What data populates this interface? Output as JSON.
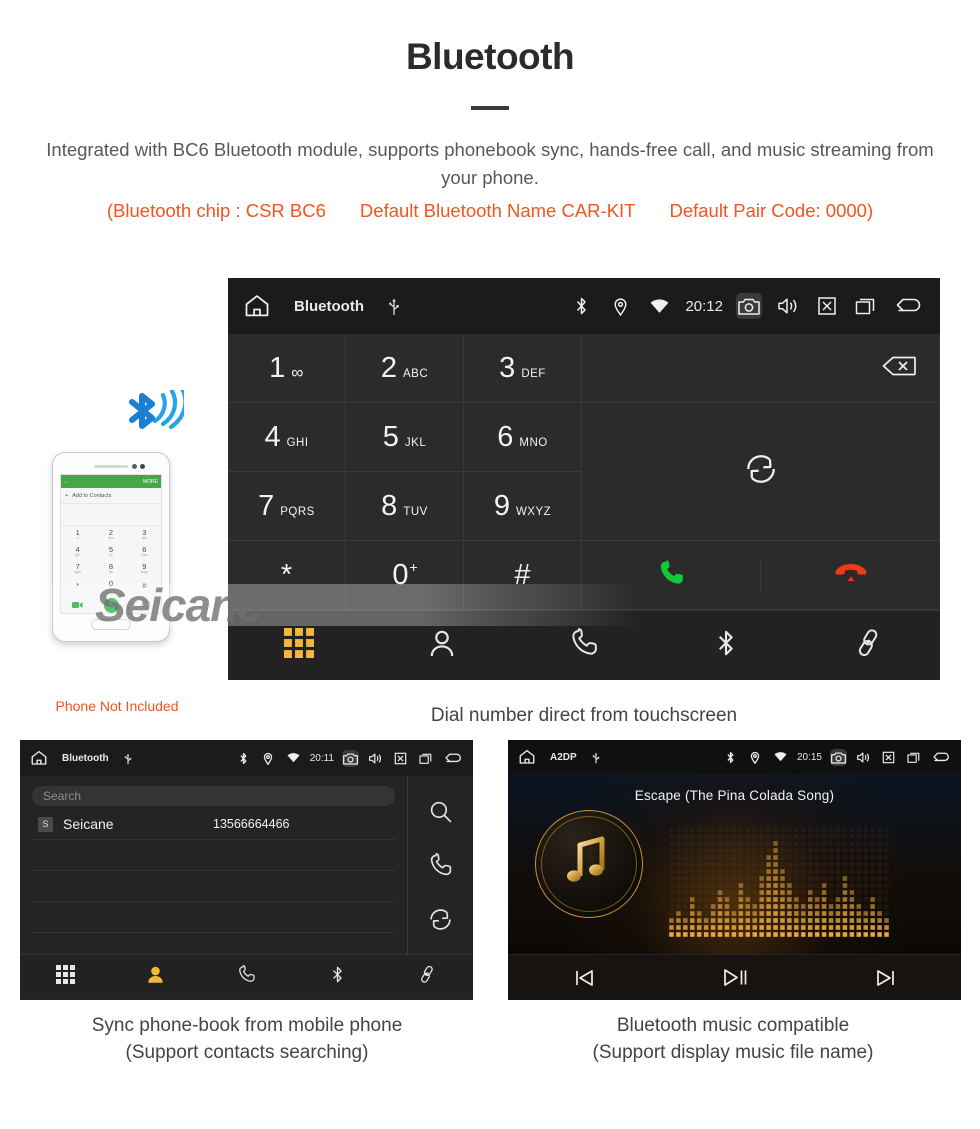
{
  "header": {
    "title": "Bluetooth",
    "description": "Integrated with BC6 Bluetooth module, supports phonebook sync, hands-free call, and music streaming from your phone.",
    "notes": [
      "(Bluetooth chip : CSR BC6",
      "Default Bluetooth Name CAR-KIT",
      "Default Pair Code: 0000)"
    ],
    "accent_color": "#f4541f",
    "text_color": "#585858"
  },
  "watermark": "Seicane",
  "phone_mock": {
    "caption": "Phone Not Included",
    "appbar_more": "MORE",
    "add_to_contacts": "Add to Contacts",
    "back_arrow": "←",
    "plus": "+",
    "keys": [
      {
        "digit": "1",
        "sub": "∞"
      },
      {
        "digit": "2",
        "sub": "abc"
      },
      {
        "digit": "3",
        "sub": "def"
      },
      {
        "digit": "4",
        "sub": "ghi"
      },
      {
        "digit": "5",
        "sub": "jkl"
      },
      {
        "digit": "6",
        "sub": "mno"
      },
      {
        "digit": "7",
        "sub": "pqrs"
      },
      {
        "digit": "8",
        "sub": "tuv"
      },
      {
        "digit": "9",
        "sub": "wxyz"
      },
      {
        "digit": "*",
        "sub": ""
      },
      {
        "digit": "0",
        "sub": "+"
      },
      {
        "digit": "#",
        "sub": ""
      }
    ],
    "bluetooth_glyph": "ᛦ"
  },
  "dialer": {
    "statusbar": {
      "home_icon": "home-icon",
      "title": "Bluetooth",
      "usb_icon": "usb-icon",
      "bt_icon": "bluetooth-icon",
      "gps_icon": "location-icon",
      "wifi_icon": "wifi-icon",
      "time": "20:12",
      "camera_icon": "camera-icon",
      "volume_icon": "volume-icon",
      "close_icon": "close-box-icon",
      "recents_icon": "recents-icon",
      "back_icon": "back-icon"
    },
    "keys": [
      {
        "digit": "1",
        "sub": "∞",
        "kind": "voicemail"
      },
      {
        "digit": "2",
        "sub": "ABC",
        "kind": "letters"
      },
      {
        "digit": "3",
        "sub": "DEF",
        "kind": "letters"
      },
      {
        "digit": "4",
        "sub": "GHI",
        "kind": "letters"
      },
      {
        "digit": "5",
        "sub": "JKL",
        "kind": "letters"
      },
      {
        "digit": "6",
        "sub": "MNO",
        "kind": "letters"
      },
      {
        "digit": "7",
        "sub": "PQRS",
        "kind": "letters"
      },
      {
        "digit": "8",
        "sub": "TUV",
        "kind": "letters"
      },
      {
        "digit": "9",
        "sub": "WXYZ",
        "kind": "letters"
      },
      {
        "digit": "*",
        "sub": "",
        "kind": "symbol"
      },
      {
        "digit": "0",
        "sub": "+",
        "kind": "sup"
      },
      {
        "digit": "#",
        "sub": "",
        "kind": "symbol"
      }
    ],
    "backspace_icon": "backspace-icon",
    "sync_icon": "sync-icon",
    "call_icon": "call-icon",
    "hangup_icon": "hangup-icon",
    "call_color": "#12c93a",
    "hangup_color": "#f03a18",
    "nav": [
      {
        "name": "keypad",
        "icon": "keypad-grid-icon",
        "active": true
      },
      {
        "name": "contacts",
        "icon": "person-icon",
        "active": false
      },
      {
        "name": "call-log",
        "icon": "handset-icon",
        "active": false
      },
      {
        "name": "bluetooth",
        "icon": "bluetooth-icon",
        "active": false
      },
      {
        "name": "pair-link",
        "icon": "link-icon",
        "active": false
      }
    ],
    "active_color": "#f5b63c",
    "caption": "Dial number direct from touchscreen"
  },
  "phonebook": {
    "statusbar": {
      "title": "Bluetooth",
      "time": "20:11"
    },
    "search_placeholder": "Search",
    "columns": [
      "name",
      "number"
    ],
    "contacts": [
      {
        "initial": "S",
        "name": "Seicane",
        "number": "13566664466"
      }
    ],
    "empty_rows": 3,
    "side_actions": [
      {
        "name": "search",
        "icon": "search-icon"
      },
      {
        "name": "call",
        "icon": "handset-icon"
      },
      {
        "name": "sync",
        "icon": "sync-icon"
      }
    ],
    "nav": [
      {
        "name": "keypad",
        "icon": "keypad-grid-icon",
        "active": false
      },
      {
        "name": "contacts",
        "icon": "person-icon",
        "active": true
      },
      {
        "name": "call-log",
        "icon": "handset-icon",
        "active": false
      },
      {
        "name": "bluetooth",
        "icon": "bluetooth-icon",
        "active": false
      },
      {
        "name": "pair-link",
        "icon": "link-icon",
        "active": false
      }
    ],
    "caption_line1": "Sync phone-book from mobile phone",
    "caption_line2": "(Support contacts searching)"
  },
  "music": {
    "statusbar": {
      "title": "A2DP",
      "time": "20:15"
    },
    "song_title": "Escape (The Pina Colada Song)",
    "album_icon": "music-note-bluetooth-icon",
    "accent_color": "#d79a33",
    "controls": [
      {
        "name": "previous",
        "icon": "previous-track-icon",
        "glyph": "prev"
      },
      {
        "name": "play-pause",
        "icon": "play-pause-icon",
        "glyph": "playpause"
      },
      {
        "name": "next",
        "icon": "next-track-icon",
        "glyph": "next"
      }
    ],
    "equalizer": {
      "columns": 32,
      "rows": 16,
      "levels": [
        3,
        4,
        3,
        6,
        4,
        3,
        5,
        7,
        6,
        4,
        8,
        6,
        5,
        9,
        12,
        14,
        10,
        8,
        6,
        5,
        7,
        6,
        8,
        5,
        6,
        9,
        7,
        5,
        4,
        6,
        4,
        3
      ]
    },
    "caption_line1": "Bluetooth music compatible",
    "caption_line2": "(Support display music file name)"
  }
}
